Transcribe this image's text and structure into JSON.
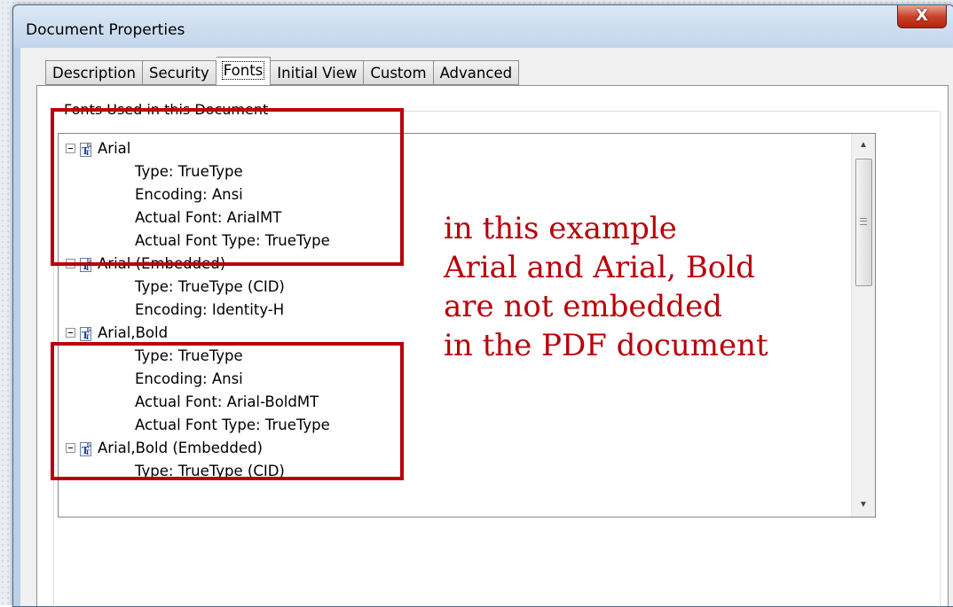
{
  "window": {
    "title": "Document Properties",
    "close_label": "X"
  },
  "tabs": [
    {
      "label": "Description",
      "active": false
    },
    {
      "label": "Security",
      "active": false
    },
    {
      "label": "Fonts",
      "active": true
    },
    {
      "label": "Initial View",
      "active": false
    },
    {
      "label": "Custom",
      "active": false
    },
    {
      "label": "Advanced",
      "active": false
    }
  ],
  "fonts_group": {
    "label": "Fonts Used in this Document",
    "items": [
      {
        "name": "Arial",
        "props": [
          "Type: TrueType",
          "Encoding: Ansi",
          "Actual Font: ArialMT",
          "Actual Font Type: TrueType"
        ]
      },
      {
        "name": "Arial (Embedded)",
        "props": [
          "Type: TrueType (CID)",
          "Encoding: Identity-H"
        ]
      },
      {
        "name": "Arial,Bold",
        "props": [
          "Type: TrueType",
          "Encoding: Ansi",
          "Actual Font: Arial-BoldMT",
          "Actual Font Type: TrueType"
        ]
      },
      {
        "name": "Arial,Bold (Embedded)",
        "props": [
          "Type: TrueType (CID)"
        ]
      }
    ]
  },
  "annotation": {
    "lines": [
      "in this example",
      "Arial and Arial, Bold",
      "are not embedded",
      "in the PDF document"
    ],
    "color": "#b8000a"
  },
  "icons": {
    "expander": "minus-box-icon",
    "font": "truetype-font-icon"
  }
}
